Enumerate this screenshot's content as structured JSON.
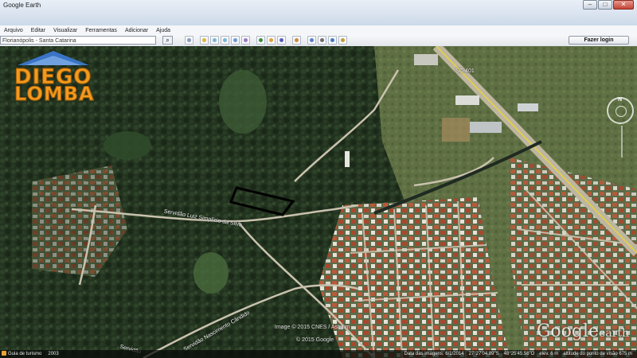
{
  "window": {
    "title": "Google Earth",
    "btn_min": "–",
    "btn_max": "□",
    "btn_close": "✕"
  },
  "menu": {
    "items": [
      "Arquivo",
      "Editar",
      "Visualizar",
      "Ferramentas",
      "Adicionar",
      "Ajuda"
    ]
  },
  "toolbar": {
    "search_value": "Florianópolis - Santa Catarina",
    "login_label": "Fazer login"
  },
  "logo": {
    "line1": "DIEGO",
    "line2": "LOMBA"
  },
  "map": {
    "compass_n": "N",
    "road_labels": [
      "Servidão Luiz Simplício da Silva",
      "Servidão Nascimento Cândido",
      "Servidão",
      "SC-401"
    ],
    "copyright_image": "Image © 2015 CNES / Astrium",
    "copyright_google": "© 2015 Google",
    "brand": "Google",
    "brand_suffix": "earth"
  },
  "status": {
    "tour_label": "Guia de turismo",
    "year": "2003",
    "imagery_date": "Data das imagens: 6/1/2014",
    "lat": "27°27'04.89\"S",
    "lon": "48°25'45.56\"O",
    "elev": "elev.    6 m",
    "eye_alt": "altitude do ponto de visão    675 m"
  },
  "colors": {
    "forest": "#22331f",
    "road": "#c9c2ae",
    "highway_line": "#e8d33a",
    "logo_orange": "#f39a1e",
    "logo_blue": "#3a74c6"
  }
}
